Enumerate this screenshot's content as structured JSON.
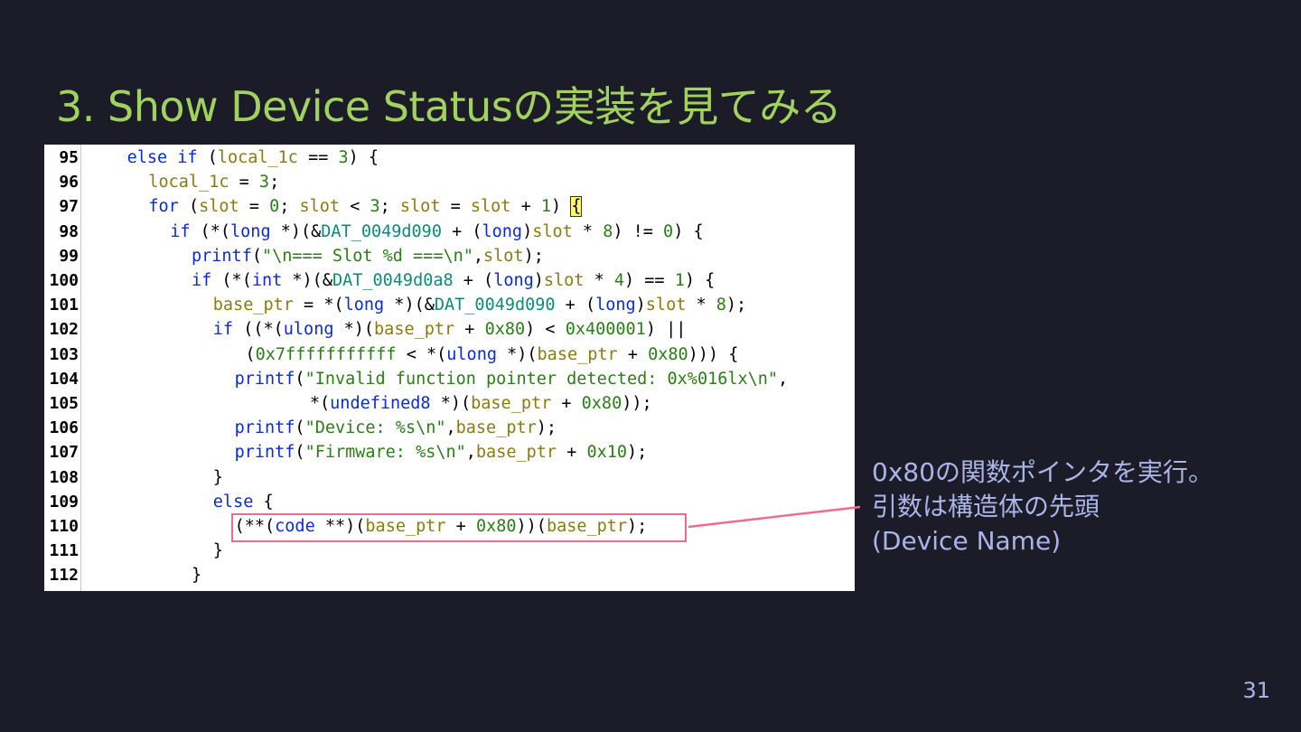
{
  "slide": {
    "title": "3. Show Device Statusの実装を見てみる",
    "page_number": "31"
  },
  "code": {
    "lines": [
      {
        "no": "95",
        "indent": 2,
        "tokens": [
          [
            "k",
            "else if"
          ],
          [
            "p",
            " ("
          ],
          [
            "v",
            "local_1c"
          ],
          [
            "p",
            " == "
          ],
          [
            "n",
            "3"
          ],
          [
            "p",
            ") {"
          ]
        ]
      },
      {
        "no": "96",
        "indent": 3,
        "tokens": [
          [
            "v",
            "local_1c"
          ],
          [
            "p",
            " = "
          ],
          [
            "n",
            "3"
          ],
          [
            "p",
            ";"
          ]
        ]
      },
      {
        "no": "97",
        "indent": 3,
        "tokens": [
          [
            "k",
            "for"
          ],
          [
            "p",
            " ("
          ],
          [
            "v",
            "slot"
          ],
          [
            "p",
            " = "
          ],
          [
            "n",
            "0"
          ],
          [
            "p",
            "; "
          ],
          [
            "v",
            "slot"
          ],
          [
            "p",
            " < "
          ],
          [
            "n",
            "3"
          ],
          [
            "p",
            "; "
          ],
          [
            "v",
            "slot"
          ],
          [
            "p",
            " = "
          ],
          [
            "v",
            "slot"
          ],
          [
            "p",
            " + "
          ],
          [
            "n",
            "1"
          ],
          [
            "p",
            ") "
          ],
          [
            "hl",
            "{"
          ]
        ]
      },
      {
        "no": "98",
        "indent": 4,
        "tokens": [
          [
            "k",
            "if"
          ],
          [
            "p",
            " (*("
          ],
          [
            "k",
            "long"
          ],
          [
            "p",
            " *)(&"
          ],
          [
            "g",
            "DAT_0049d090"
          ],
          [
            "p",
            " + ("
          ],
          [
            "k",
            "long"
          ],
          [
            "p",
            ")"
          ],
          [
            "v",
            "slot"
          ],
          [
            "p",
            " * "
          ],
          [
            "n",
            "8"
          ],
          [
            "p",
            ") != "
          ],
          [
            "n",
            "0"
          ],
          [
            "p",
            ") {"
          ]
        ]
      },
      {
        "no": "99",
        "indent": 5,
        "tokens": [
          [
            "k",
            "printf"
          ],
          [
            "p",
            "("
          ],
          [
            "s",
            "\"\\n=== Slot %d ===\\n\""
          ],
          [
            "p",
            ","
          ],
          [
            "v",
            "slot"
          ],
          [
            "p",
            ");"
          ]
        ]
      },
      {
        "no": "100",
        "indent": 5,
        "tokens": [
          [
            "k",
            "if"
          ],
          [
            "p",
            " (*("
          ],
          [
            "k",
            "int"
          ],
          [
            "p",
            " *)(&"
          ],
          [
            "g",
            "DAT_0049d0a8"
          ],
          [
            "p",
            " + ("
          ],
          [
            "k",
            "long"
          ],
          [
            "p",
            ")"
          ],
          [
            "v",
            "slot"
          ],
          [
            "p",
            " * "
          ],
          [
            "n",
            "4"
          ],
          [
            "p",
            ") == "
          ],
          [
            "n",
            "1"
          ],
          [
            "p",
            ") {"
          ]
        ]
      },
      {
        "no": "101",
        "indent": 6,
        "tokens": [
          [
            "v",
            "base_ptr"
          ],
          [
            "p",
            " = *("
          ],
          [
            "k",
            "long"
          ],
          [
            "p",
            " *)(&"
          ],
          [
            "g",
            "DAT_0049d090"
          ],
          [
            "p",
            " + ("
          ],
          [
            "k",
            "long"
          ],
          [
            "p",
            ")"
          ],
          [
            "v",
            "slot"
          ],
          [
            "p",
            " * "
          ],
          [
            "n",
            "8"
          ],
          [
            "p",
            ");"
          ]
        ]
      },
      {
        "no": "102",
        "indent": 6,
        "tokens": [
          [
            "k",
            "if"
          ],
          [
            "p",
            " ((*("
          ],
          [
            "k",
            "ulong"
          ],
          [
            "p",
            " *)("
          ],
          [
            "v",
            "base_ptr"
          ],
          [
            "p",
            " + "
          ],
          [
            "n",
            "0x80"
          ],
          [
            "p",
            ") < "
          ],
          [
            "n",
            "0x400001"
          ],
          [
            "p",
            ") ||"
          ]
        ]
      },
      {
        "no": "103",
        "indent": 7.5,
        "tokens": [
          [
            "p",
            "("
          ],
          [
            "n",
            "0x7fffffffffff"
          ],
          [
            "p",
            " < *("
          ],
          [
            "k",
            "ulong"
          ],
          [
            "p",
            " *)("
          ],
          [
            "v",
            "base_ptr"
          ],
          [
            "p",
            " + "
          ],
          [
            "n",
            "0x80"
          ],
          [
            "p",
            "))) {"
          ]
        ]
      },
      {
        "no": "104",
        "indent": 7,
        "tokens": [
          [
            "k",
            "printf"
          ],
          [
            "p",
            "("
          ],
          [
            "s",
            "\"Invalid function pointer detected: 0x%016lx\\n\""
          ],
          [
            "p",
            ","
          ]
        ]
      },
      {
        "no": "105",
        "indent": 10.5,
        "tokens": [
          [
            "p",
            "*("
          ],
          [
            "k",
            "undefined8"
          ],
          [
            "p",
            " *)("
          ],
          [
            "v",
            "base_ptr"
          ],
          [
            "p",
            " + "
          ],
          [
            "n",
            "0x80"
          ],
          [
            "p",
            "));"
          ]
        ]
      },
      {
        "no": "106",
        "indent": 7,
        "tokens": [
          [
            "k",
            "printf"
          ],
          [
            "p",
            "("
          ],
          [
            "s",
            "\"Device: %s\\n\""
          ],
          [
            "p",
            ","
          ],
          [
            "v",
            "base_ptr"
          ],
          [
            "p",
            ");"
          ]
        ]
      },
      {
        "no": "107",
        "indent": 7,
        "tokens": [
          [
            "k",
            "printf"
          ],
          [
            "p",
            "("
          ],
          [
            "s",
            "\"Firmware: %s\\n\""
          ],
          [
            "p",
            ","
          ],
          [
            "v",
            "base_ptr"
          ],
          [
            "p",
            " + "
          ],
          [
            "n",
            "0x10"
          ],
          [
            "p",
            ");"
          ]
        ]
      },
      {
        "no": "108",
        "indent": 6,
        "tokens": [
          [
            "p",
            "}"
          ]
        ]
      },
      {
        "no": "109",
        "indent": 6,
        "tokens": [
          [
            "k",
            "else"
          ],
          [
            "p",
            " {"
          ]
        ]
      },
      {
        "no": "110",
        "indent": 7,
        "tokens": [
          [
            "p",
            "(**("
          ],
          [
            "k",
            "code"
          ],
          [
            "p",
            " **)("
          ],
          [
            "v",
            "base_ptr"
          ],
          [
            "p",
            " + "
          ],
          [
            "n",
            "0x80"
          ],
          [
            "p",
            "))("
          ],
          [
            "v",
            "base_ptr"
          ],
          [
            "p",
            ");"
          ]
        ]
      },
      {
        "no": "111",
        "indent": 6,
        "tokens": [
          [
            "p",
            "}"
          ]
        ]
      },
      {
        "no": "112",
        "indent": 5,
        "tokens": [
          [
            "p",
            "}"
          ]
        ]
      }
    ]
  },
  "note": {
    "line1": "0x80の関数ポインタを実行。",
    "line2": "引数は構造体の先頭",
    "line3": "(Device Name)"
  },
  "colors": {
    "background": "#1c1c29",
    "title": "#a1d25e",
    "note": "#aab4e6",
    "highlight_box": "#ef6c8c"
  }
}
